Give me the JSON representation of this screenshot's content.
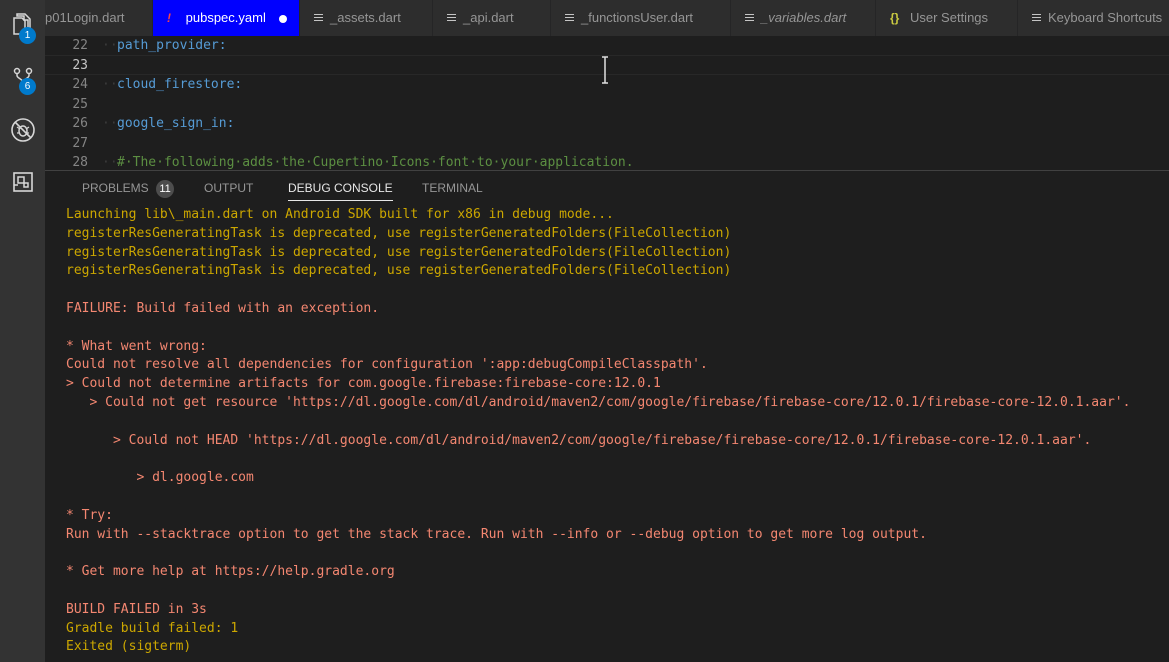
{
  "activity_bar": {
    "items": [
      {
        "name": "explorer",
        "badge": "1"
      },
      {
        "name": "source-control",
        "badge": "6"
      },
      {
        "name": "debug",
        "badge": ""
      },
      {
        "name": "extensions",
        "badge": ""
      }
    ]
  },
  "tabs": [
    {
      "label": "p01Login.dart",
      "icon": "lines-icon"
    },
    {
      "label": "pubspec.yaml",
      "icon": "exclamation-icon",
      "active": true,
      "dirty": true
    },
    {
      "label": "_assets.dart",
      "icon": "lines-icon"
    },
    {
      "label": "_api.dart",
      "icon": "lines-icon"
    },
    {
      "label": "_functionsUser.dart",
      "icon": "lines-icon"
    },
    {
      "label": "_variables.dart",
      "icon": "lines-icon"
    },
    {
      "label": "User Settings",
      "icon": "json-braces-icon"
    },
    {
      "label": "Keyboard Shortcuts",
      "icon": "lines-icon"
    }
  ],
  "tab_icons": {
    "json": "{}",
    "warn": "!"
  },
  "editor": {
    "lines": [
      {
        "num": "22",
        "dots": "··",
        "text": "path_provider:",
        "kind": "key"
      },
      {
        "num": "23",
        "dots": "",
        "text": "",
        "kind": "key",
        "current": true
      },
      {
        "num": "24",
        "dots": "··",
        "text": "cloud_firestore:",
        "kind": "key"
      },
      {
        "num": "25",
        "dots": "",
        "text": "",
        "kind": "key"
      },
      {
        "num": "26",
        "dots": "··",
        "text": "google_sign_in:",
        "kind": "key"
      },
      {
        "num": "27",
        "dots": "",
        "text": "",
        "kind": "key"
      },
      {
        "num": "28",
        "dots": "··",
        "text": "#·The·following·adds·the·Cupertino·Icons·font·to·your·application.",
        "kind": "comment"
      }
    ]
  },
  "panel": {
    "tabs": {
      "problems": "PROBLEMS",
      "problems_count": "11",
      "output": "OUTPUT",
      "debug_console": "DEBUG CONSOLE",
      "terminal": "TERMINAL"
    },
    "console_lines": [
      {
        "text": "Launching lib\\_main.dart on Android SDK built for x86 in debug mode...",
        "kind": "info"
      },
      {
        "text": "registerResGeneratingTask is deprecated, use registerGeneratedFolders(FileCollection)",
        "kind": "info"
      },
      {
        "text": "registerResGeneratingTask is deprecated, use registerGeneratedFolders(FileCollection)",
        "kind": "info"
      },
      {
        "text": "registerResGeneratingTask is deprecated, use registerGeneratedFolders(FileCollection)",
        "kind": "info"
      },
      {
        "text": "",
        "kind": "err"
      },
      {
        "text": "FAILURE: Build failed with an exception.",
        "kind": "err"
      },
      {
        "text": "",
        "kind": "err"
      },
      {
        "text": "* What went wrong:",
        "kind": "err"
      },
      {
        "text": "Could not resolve all dependencies for configuration ':app:debugCompileClasspath'.",
        "kind": "err"
      },
      {
        "text": "> Could not determine artifacts for com.google.firebase:firebase-core:12.0.1",
        "kind": "err"
      },
      {
        "text": "   > Could not get resource 'https://dl.google.com/dl/android/maven2/com/google/firebase/firebase-core/12.0.1/firebase-core-12.0.1.aar'.",
        "kind": "err"
      },
      {
        "text": "",
        "kind": "err"
      },
      {
        "text": "      > Could not HEAD 'https://dl.google.com/dl/android/maven2/com/google/firebase/firebase-core/12.0.1/firebase-core-12.0.1.aar'.",
        "kind": "err"
      },
      {
        "text": "",
        "kind": "err"
      },
      {
        "text": "         > dl.google.com",
        "kind": "err"
      },
      {
        "text": "",
        "kind": "err"
      },
      {
        "text": "* Try:",
        "kind": "err"
      },
      {
        "text": "Run with --stacktrace option to get the stack trace. Run with --info or --debug option to get more log output.",
        "kind": "err"
      },
      {
        "text": "",
        "kind": "err"
      },
      {
        "text": "* Get more help at https://help.gradle.org",
        "kind": "err"
      },
      {
        "text": "",
        "kind": "err"
      },
      {
        "text": "BUILD FAILED in 3s",
        "kind": "err"
      },
      {
        "text": "Gradle build failed: 1",
        "kind": "info"
      },
      {
        "text": "Exited (sigterm)",
        "kind": "info"
      }
    ]
  }
}
